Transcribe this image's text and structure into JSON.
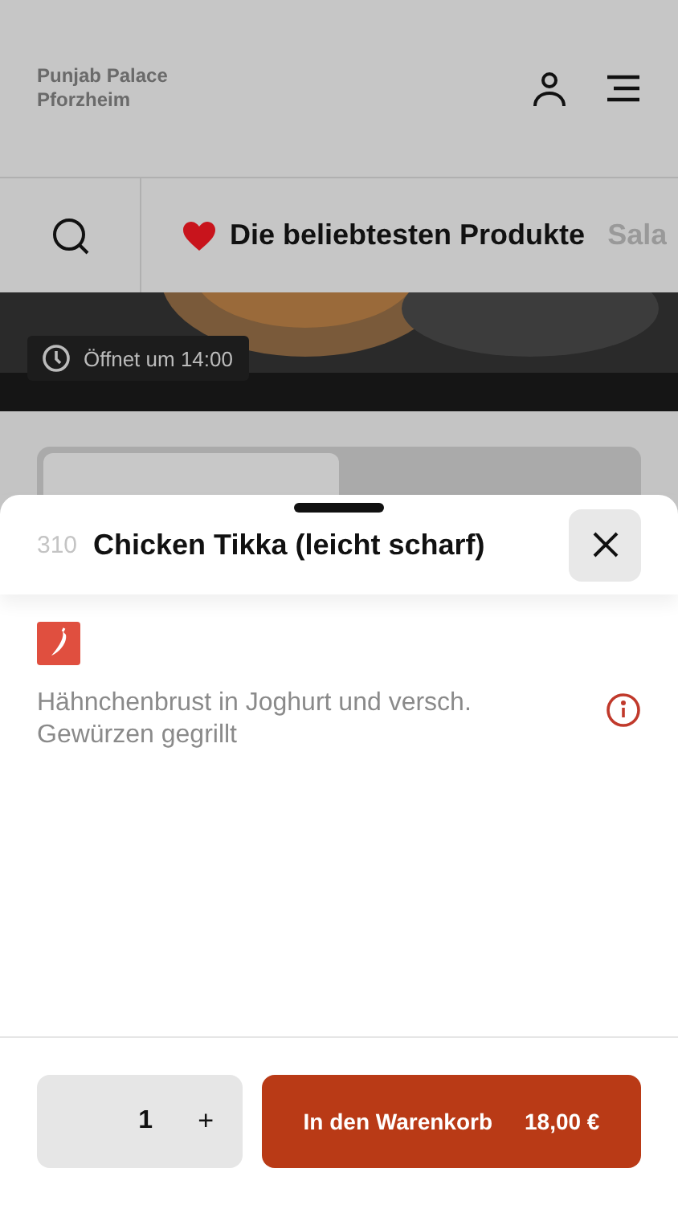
{
  "header": {
    "restaurant_name": [
      "Punjab Palace",
      "Pforzheim"
    ]
  },
  "categories": [
    {
      "label": "Die beliebtesten Produkte",
      "selected": true
    },
    {
      "label": "Sala",
      "selected": false
    }
  ],
  "hero": {
    "kind": "picture",
    "opening_badge": "Öffnet um 14:00"
  },
  "order_mode_tabs": [
    {
      "selected": true
    },
    {
      "selected": false
    }
  ],
  "product": {
    "number": "310",
    "name": "Chicken Tikka (leicht scharf)",
    "spicy": true,
    "description": "Hähnchenbrust in Joghurt und versch. Gewürzen gegrillt"
  },
  "cart": {
    "quantity": "1",
    "plus": "+",
    "add_label": "In den Warenkorb",
    "price": "18,00 €"
  }
}
